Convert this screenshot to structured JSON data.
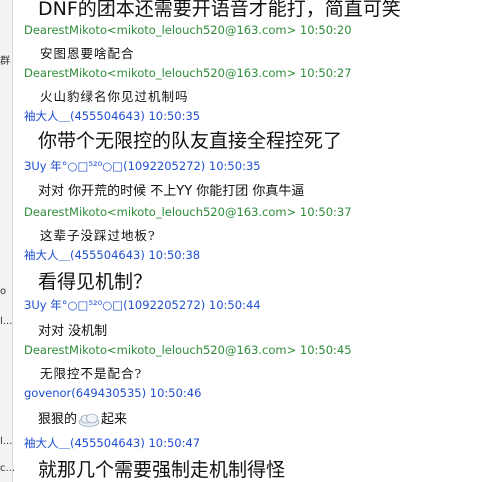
{
  "sidebar": {
    "fragments": [
      "群",
      "o",
      "l...",
      "",
      "l...",
      "c..."
    ]
  },
  "chat": {
    "messages": [
      {
        "header": "",
        "body": "DNF的团本还需要开语音才能打，简直可笑",
        "style": "big"
      },
      {
        "header": "DearestMikoto<mikoto_lelouch520@163.com> 10:50:20",
        "color": "green",
        "body": "安图恩要啥配合",
        "style": "serif"
      },
      {
        "header": "DearestMikoto<mikoto_lelouch520@163.com> 10:50:27",
        "color": "green",
        "body": "火山豹绿名你见过机制吗",
        "style": "serif"
      },
      {
        "header": "袖大人＿(455504643) 10:50:35",
        "color": "blue",
        "body": "你带个无限控的队友直接全程控死了",
        "style": "big"
      },
      {
        "header": "ЗUу 年°○□⁵²⁰○□(1092205272) 10:50:35",
        "color": "blue",
        "body": "对对 你开荒的时候 不上YY 你能打团 你真牛逼",
        "style": "mid"
      },
      {
        "header": "DearestMikoto<mikoto_lelouch520@163.com> 10:50:37",
        "color": "green",
        "body": "这辈子没踩过地板?",
        "style": "serif"
      },
      {
        "header": "袖大人＿(455504643) 10:50:38",
        "color": "blue",
        "body": "看得见机制？",
        "style": "big"
      },
      {
        "header": "ЗUу 年°○□⁵²⁰○□(1092205272) 10:50:44",
        "color": "blue",
        "body": "对对 没机制",
        "style": "mid"
      },
      {
        "header": "DearestMikoto<mikoto_lelouch520@163.com> 10:50:45",
        "color": "green",
        "body": "无限控不是配合?",
        "style": "serif"
      },
      {
        "header": "govenor(649430535) 10:50:46",
        "color": "blue",
        "body_before": "狠狠的",
        "body_after": "起来",
        "style": "mid",
        "icon": "cloud-emoticon"
      },
      {
        "header": "袖大人＿(455504643) 10:50:47",
        "color": "blue",
        "body": "就那几个需要强制走机制得怪",
        "style": "big"
      }
    ]
  }
}
